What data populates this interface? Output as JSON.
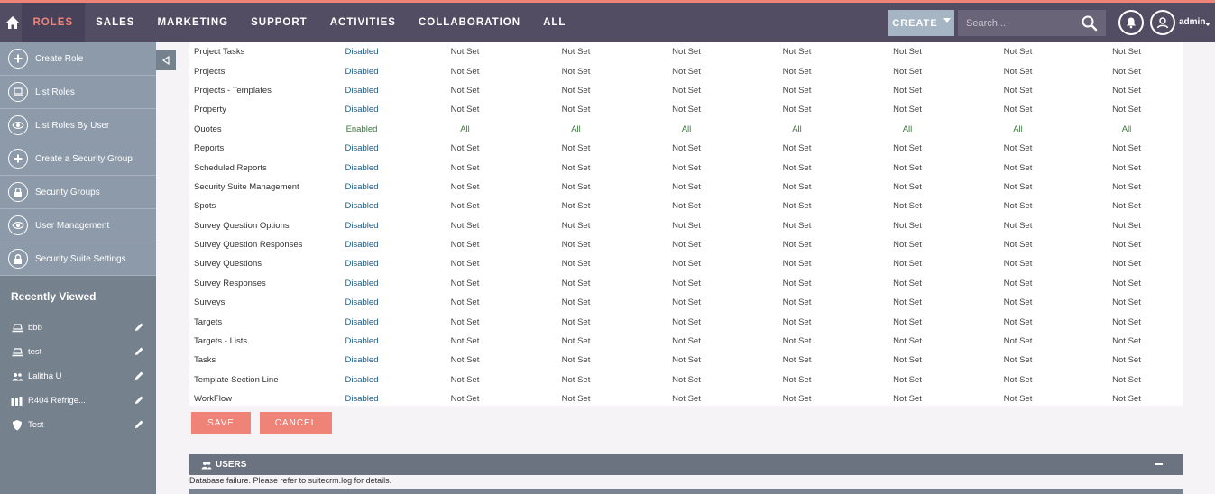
{
  "nav": {
    "home_icon": "home-icon",
    "items": [
      "ROLES",
      "SALES",
      "MARKETING",
      "SUPPORT",
      "ACTIVITIES",
      "COLLABORATION",
      "ALL"
    ],
    "active_index": 0,
    "create_label": "CREATE",
    "search_placeholder": "Search...",
    "user_label": "admin"
  },
  "colors": {
    "topbar": "#534d64",
    "accent": "#f08377",
    "sidebar": "#76818e",
    "enabled": "#3c763d",
    "disabled": "#1a5d8c"
  },
  "sidebar": {
    "actions": [
      {
        "label": "Create Role",
        "icon": "plus-icon"
      },
      {
        "label": "List Roles",
        "icon": "list-icon"
      },
      {
        "label": "List Roles By User",
        "icon": "eye-icon"
      },
      {
        "label": "Create a Security Group",
        "icon": "plus-icon"
      },
      {
        "label": "Security Groups",
        "icon": "lock-icon"
      },
      {
        "label": "User Management",
        "icon": "eye-icon"
      },
      {
        "label": "Security Suite Settings",
        "icon": "lock-icon"
      }
    ],
    "recent_title": "Recently Viewed",
    "recent": [
      {
        "label": "bbb",
        "icon": "role-icon"
      },
      {
        "label": "test",
        "icon": "role-icon"
      },
      {
        "label": "Lalitha U",
        "icon": "users-icon"
      },
      {
        "label": "R404 Refrige...",
        "icon": "chart-icon"
      },
      {
        "label": "Test",
        "icon": "shield-icon"
      }
    ]
  },
  "roles": [
    {
      "module": "Project Tasks",
      "access": "Disabled",
      "value": "Not Set"
    },
    {
      "module": "Projects",
      "access": "Disabled",
      "value": "Not Set"
    },
    {
      "module": "Projects - Templates",
      "access": "Disabled",
      "value": "Not Set"
    },
    {
      "module": "Property",
      "access": "Disabled",
      "value": "Not Set"
    },
    {
      "module": "Quotes",
      "access": "Enabled",
      "value": "All"
    },
    {
      "module": "Reports",
      "access": "Disabled",
      "value": "Not Set"
    },
    {
      "module": "Scheduled Reports",
      "access": "Disabled",
      "value": "Not Set"
    },
    {
      "module": "Security Suite Management",
      "access": "Disabled",
      "value": "Not Set"
    },
    {
      "module": "Spots",
      "access": "Disabled",
      "value": "Not Set"
    },
    {
      "module": "Survey Question Options",
      "access": "Disabled",
      "value": "Not Set"
    },
    {
      "module": "Survey Question Responses",
      "access": "Disabled",
      "value": "Not Set"
    },
    {
      "module": "Survey Questions",
      "access": "Disabled",
      "value": "Not Set"
    },
    {
      "module": "Survey Responses",
      "access": "Disabled",
      "value": "Not Set"
    },
    {
      "module": "Surveys",
      "access": "Disabled",
      "value": "Not Set"
    },
    {
      "module": "Targets",
      "access": "Disabled",
      "value": "Not Set"
    },
    {
      "module": "Targets - Lists",
      "access": "Disabled",
      "value": "Not Set"
    },
    {
      "module": "Tasks",
      "access": "Disabled",
      "value": "Not Set"
    },
    {
      "module": "Template Section Line",
      "access": "Disabled",
      "value": "Not Set"
    },
    {
      "module": "WorkFlow",
      "access": "Disabled",
      "value": "Not Set"
    }
  ],
  "permission_column_count": 7,
  "buttons": {
    "save": "SAVE",
    "cancel": "CANCEL"
  },
  "users_panel": {
    "title": "USERS",
    "error": "Database failure. Please refer to suitecrm.log for details."
  }
}
